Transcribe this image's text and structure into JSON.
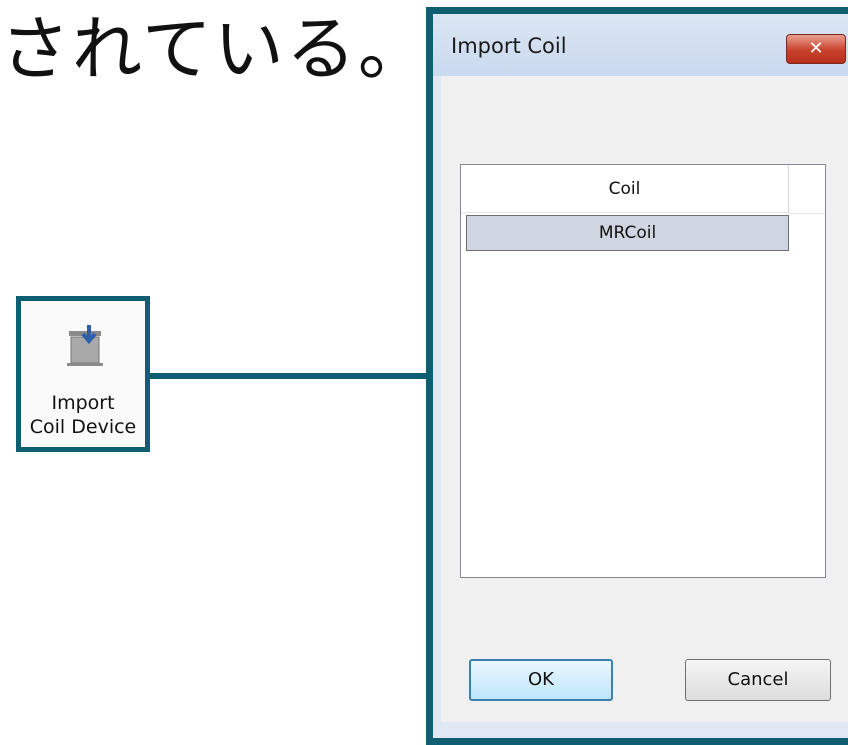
{
  "headline": "されている。",
  "ribbon": {
    "icon": "import-coil-device-icon",
    "label_line1": "Import",
    "label_line2": "Coil Device"
  },
  "dialog": {
    "title": "Import Coil",
    "close_label": "✕",
    "list": {
      "column_header": "Coil",
      "rows": [
        "MRCoil"
      ]
    },
    "ok_label": "OK",
    "cancel_label": "Cancel"
  },
  "colors": {
    "callout": "#0f5f73",
    "selected_row": "#cfd6e1",
    "close_button": "#c8412c"
  }
}
